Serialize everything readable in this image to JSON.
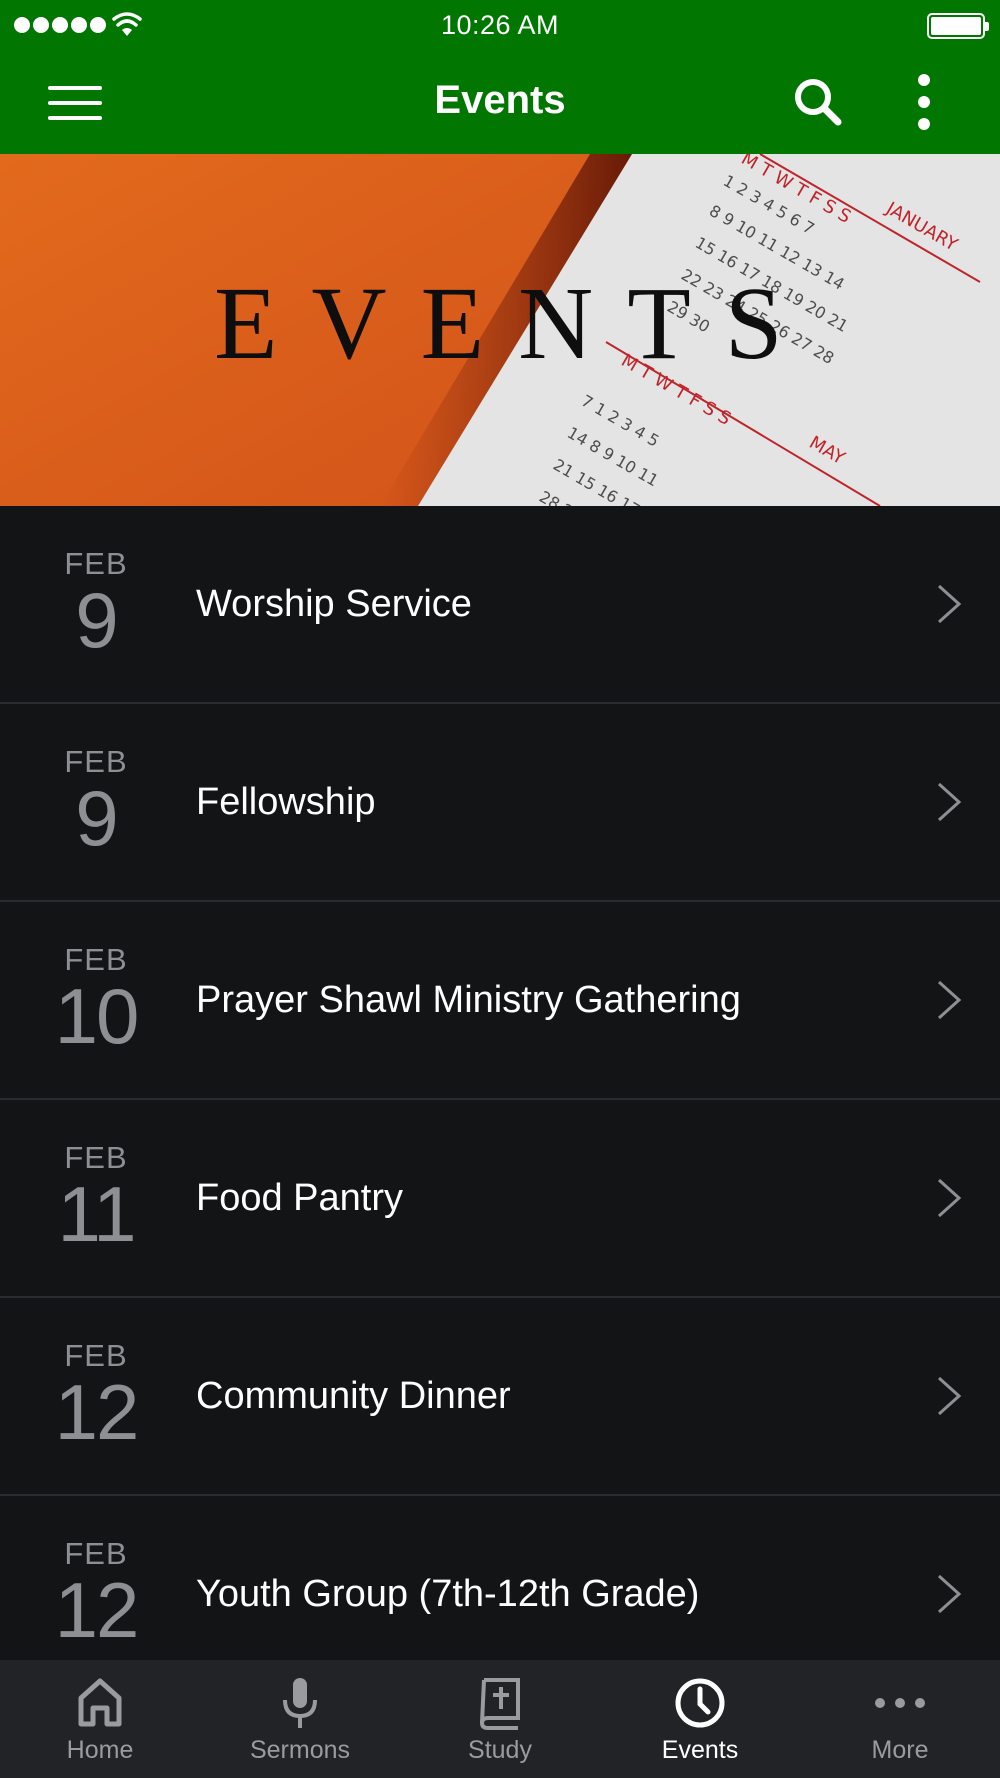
{
  "status_bar": {
    "time": "10:26 AM"
  },
  "nav": {
    "title": "Events"
  },
  "banner": {
    "text": "EVENTS"
  },
  "events": [
    {
      "month": "FEB",
      "day": "9",
      "title": "Worship Service"
    },
    {
      "month": "FEB",
      "day": "9",
      "title": "Fellowship"
    },
    {
      "month": "FEB",
      "day": "10",
      "title": "Prayer Shawl Ministry Gathering"
    },
    {
      "month": "FEB",
      "day": "11",
      "title": "Food Pantry"
    },
    {
      "month": "FEB",
      "day": "12",
      "title": "Community Dinner"
    },
    {
      "month": "FEB",
      "day": "12",
      "title": "Youth Group (7th-12th Grade)"
    }
  ],
  "tabs": [
    {
      "label": "Home",
      "icon": "home-icon"
    },
    {
      "label": "Sermons",
      "icon": "microphone-icon"
    },
    {
      "label": "Study",
      "icon": "bible-icon"
    },
    {
      "label": "Events",
      "icon": "clock-icon",
      "active": true
    },
    {
      "label": "More",
      "icon": "more-icon"
    }
  ],
  "colors": {
    "brand_green": "#017702",
    "background": "#131416",
    "tab_bar": "#222326",
    "banner_orange": "#e0621a"
  }
}
